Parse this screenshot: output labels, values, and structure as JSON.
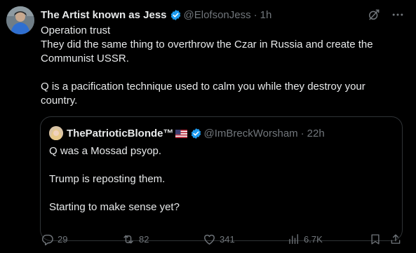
{
  "tweet": {
    "author_name": "The Artist known as Jess",
    "author_handle": "@ElofsonJess",
    "dot": "·",
    "time": "1h",
    "text_lines": [
      "Operation trust",
      "They did the same thing to overthrow the Czar in Russia and create the",
      "Communist USSR.",
      "",
      "Q is a pacification technique used to calm you while they destroy your",
      "country."
    ]
  },
  "quote": {
    "author_name": "ThePatrioticBlonde™",
    "author_handle": "@ImBreckWorsham",
    "dot": "·",
    "time": "22h",
    "text_lines": [
      "Q was a Mossad psyop.",
      "",
      "Trump is reposting them.",
      "",
      "Starting to make sense yet?"
    ]
  },
  "actions": {
    "replies": "29",
    "reposts": "82",
    "likes": "341",
    "views": "6.7K"
  },
  "colors": {
    "background": "#000000",
    "text": "#e7e9ea",
    "secondary": "#71767b",
    "verified": "#1d9bf0",
    "border": "#2f3336"
  },
  "icons": {
    "verified": "verified-badge-icon",
    "grok": "grok-icon",
    "more": "more-icon",
    "reply": "reply-icon",
    "repost": "repost-icon",
    "like": "like-icon",
    "views": "views-icon",
    "bookmark": "bookmark-icon",
    "share": "share-icon"
  }
}
